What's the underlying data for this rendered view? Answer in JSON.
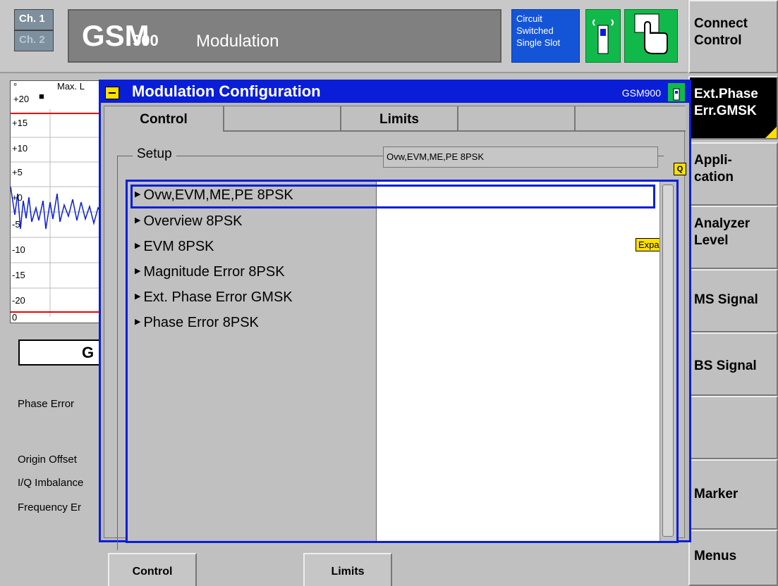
{
  "header": {
    "ch1": "Ch. 1",
    "ch2": "Ch. 2",
    "title_main": "GSM",
    "title_band": "900",
    "title_app": "Modulation",
    "status": [
      "Circuit",
      "Switched",
      "Single Slot"
    ]
  },
  "softkeys_right": [
    {
      "label": "Connect\nControl"
    },
    {
      "label": "Ext.Phase\nErr.GMSK"
    },
    {
      "label": "Appli-\ncation"
    },
    {
      "label": "Analyzer\nLevel"
    },
    {
      "label": "MS Signal"
    },
    {
      "label": "BS Signal"
    },
    {
      "label": ""
    },
    {
      "label": "Marker"
    },
    {
      "label": "Menus"
    }
  ],
  "graph": {
    "top_label": "Max. L",
    "degree": "°",
    "ticks": [
      "+20",
      "+15",
      "+10",
      "+5",
      "+0",
      "-5",
      "-10",
      "-15",
      "-20"
    ],
    "zero": "0"
  },
  "background": {
    "box_letter": "G",
    "labels": [
      "Phase Error",
      "Origin Offset",
      "I/Q Imbalance",
      "Frequency Er"
    ]
  },
  "dialog": {
    "title": "Modulation Configuration",
    "band": "GSM900",
    "tabs": [
      "Control",
      "",
      "Limits",
      "",
      ""
    ],
    "setup_label": "Setup",
    "setup_value": "Ovw,EVM,ME,PE 8PSK",
    "q_badge": "Q",
    "expand": "Expand",
    "items": [
      "Ovw,EVM,ME,PE 8PSK",
      "Overview 8PSK",
      "EVM 8PSK",
      "Magnitude Error 8PSK",
      "Ext. Phase Error GMSK",
      "Phase Error 8PSK"
    ]
  },
  "bottom_softkeys": [
    "Control",
    "Limits"
  ]
}
